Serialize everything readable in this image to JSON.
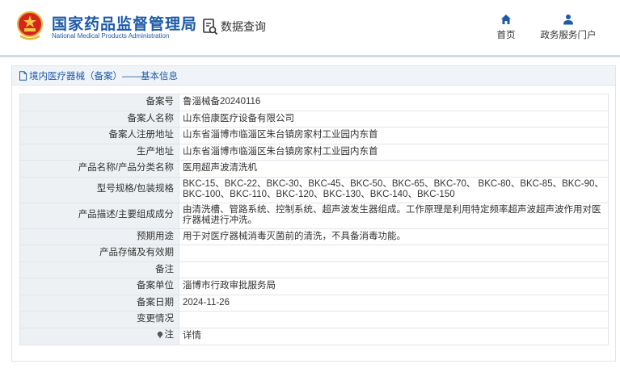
{
  "header": {
    "title_cn": "国家药品监督管理局",
    "title_en": "National Medical Products Administration",
    "query_label": "数据查询",
    "nav": {
      "home": "首页",
      "portal": "政务服务门户"
    }
  },
  "panel": {
    "breadcrumb": "境内医疗器械（备案）——基本信息"
  },
  "rows": [
    {
      "key": "备案号",
      "value": "鲁淄械备20240116"
    },
    {
      "key": "备案人名称",
      "value": "山东倍康医疗设备有限公司"
    },
    {
      "key": "备案人注册地址",
      "value": "山东省淄博市临淄区朱台镇房家村工业园内东首"
    },
    {
      "key": "生产地址",
      "value": "山东省淄博市临淄区朱台镇房家村工业园内东首"
    },
    {
      "key": "产品名称/产品分类名称",
      "value": "医用超声波清洗机"
    },
    {
      "key": "型号规格/包装规格",
      "value": "BKC-15、BKC-22、BKC-30、BKC-45、BKC-50、BKC-65、BKC-70、 BKC-80、BKC-85、BKC-90、BKC-100、BKC-110、BKC-120、BKC-130、BKC-140、BKC-150"
    },
    {
      "key": "产品描述/主要组成成分",
      "value": "由清洗槽、管路系统、控制系统、超声波发生器组成。工作原理是利用特定频率超声波超声波作用对医疗器械进行冲洗。"
    },
    {
      "key": "预期用途",
      "value": "用于对医疗器械消毒灭菌前的清洗，不具备消毒功能。"
    },
    {
      "key": "产品存储及有效期",
      "value": ""
    },
    {
      "key": "备注",
      "value": ""
    },
    {
      "key": "备案单位",
      "value": "淄博市行政审批服务局"
    },
    {
      "key": "备案日期",
      "value": "2024-11-26"
    },
    {
      "key": "变更情况",
      "value": ""
    }
  ],
  "note_row": {
    "key": "注",
    "value": "详情"
  },
  "colors": {
    "brand_blue": "#1d5aa8",
    "key_bg": "#eef1f4",
    "border": "#dfe5ec"
  },
  "icons": {
    "logo": "national-emblem-icon",
    "query": "search-document-icon",
    "home": "home-icon",
    "portal": "user-icon",
    "breadcrumb": "document-icon",
    "note": "pin-icon"
  }
}
